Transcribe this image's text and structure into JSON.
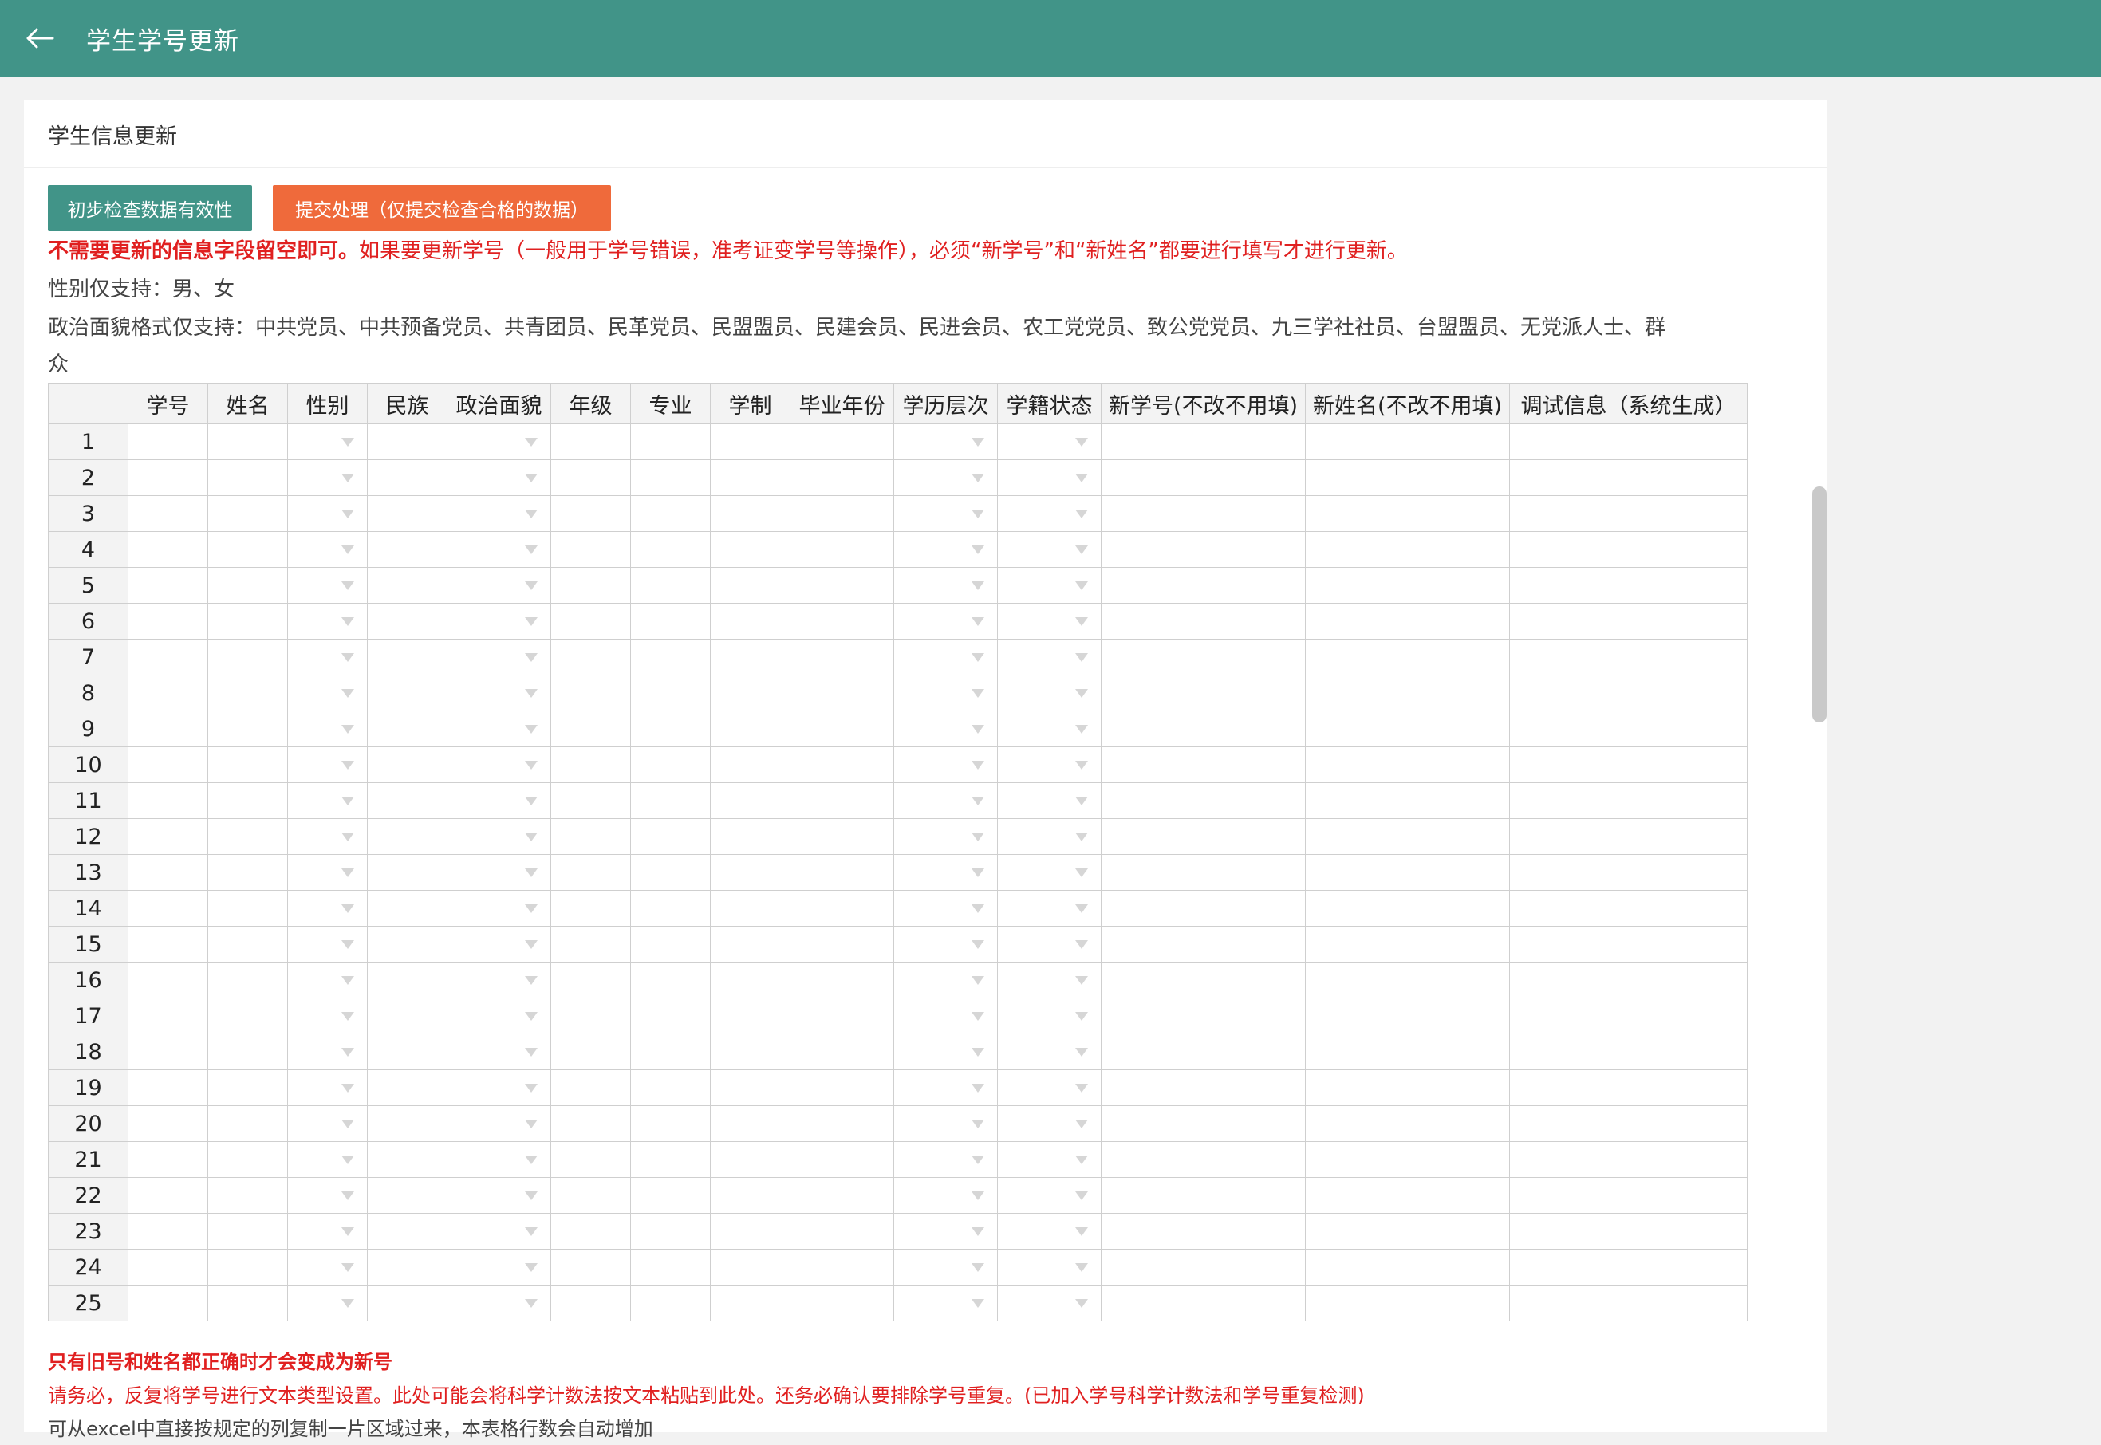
{
  "header": {
    "title": "学生学号更新"
  },
  "card": {
    "title": "学生信息更新"
  },
  "buttons": {
    "check": "初步检查数据有效性",
    "submit": "提交处理（仅提交检查合格的数据）"
  },
  "notices": {
    "line1_bold": "不需要更新的信息字段留空即可。",
    "line1_rest": "如果要更新学号（一般用于学号错误，准考证变学号等操作），必须“新学号”和“新姓名”都要进行填写才进行更新。",
    "gender": "性别仅支持：男、女",
    "politics": "政治面貌格式仅支持：中共党员、中共预备党员、共青团员、民革党员、民盟盟员、民建会员、民进会员、农工党党员、致公党党员、九三学社社员、台盟盟员、无党派人士、群",
    "politics_cont": "众"
  },
  "table": {
    "columns": [
      "学号",
      "姓名",
      "性别",
      "民族",
      "政治面貌",
      "年级",
      "专业",
      "学制",
      "毕业年份",
      "学历层次",
      "学籍状态",
      "新学号(不改不用填)",
      "新姓名(不改不用填)",
      "调试信息（系统生成）"
    ],
    "dropdown_columns": [
      2,
      4,
      9,
      10
    ],
    "rows": [
      "1",
      "2",
      "3",
      "4",
      "5",
      "6",
      "7",
      "8",
      "9",
      "10",
      "11",
      "12",
      "13",
      "14",
      "15",
      "16",
      "17",
      "18",
      "19",
      "20",
      "21",
      "22",
      "23",
      "24",
      "25"
    ]
  },
  "footer": {
    "warn1": "只有旧号和姓名都正确时才会变成为新号",
    "warn2": "请务必，反复将学号进行文本类型设置。此处可能会将科学计数法按文本粘贴到此处。还务必确认要排除学号重复。(已加入学号科学计数法和学号重复检测)",
    "tip": "可从excel中直接按规定的列复制一片区域过来，本表格行数会自动增加"
  },
  "colors": {
    "primary": "#419488",
    "accent": "#ef6a3b",
    "warning": "#e02020"
  }
}
